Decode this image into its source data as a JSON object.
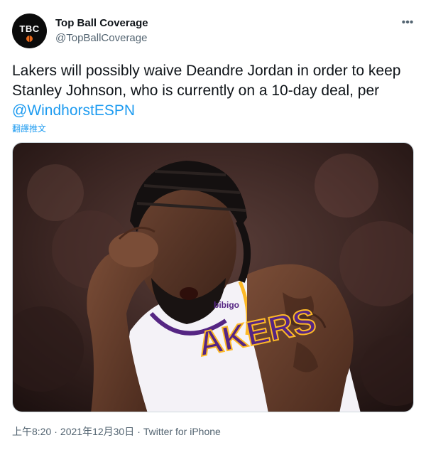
{
  "author": {
    "avatar_text": "TBC",
    "display_name": "Top Ball Coverage",
    "handle": "@TopBallCoverage"
  },
  "more_icon": "more-horizontal-icon",
  "tweet": {
    "text": "Lakers will possibly waive Deandre Jordan in order to keep Stanley Johnson, who is currently on a 10-day deal, per ",
    "mention": "@WindhorstESPN",
    "translate_label": "翻譯推文"
  },
  "photo": {
    "jersey_logo": "bibigo",
    "jersey_text": "AKERS"
  },
  "meta": {
    "time": "上午8:20",
    "separator": "·",
    "date": "2021年12月30日",
    "source": "Twitter for iPhone"
  },
  "colors": {
    "text": "#0f1419",
    "secondary": "#536471",
    "link": "#1d9bf0",
    "jersey": "#f4f2f7",
    "purple": "#552583",
    "gold": "#fdb927"
  }
}
